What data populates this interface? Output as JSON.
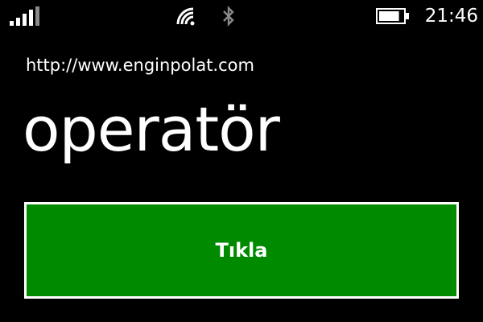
{
  "status_bar": {
    "time": "21:46",
    "icons": {
      "signal": "signal-strength-icon",
      "wifi": "wifi-icon",
      "bluetooth": "bluetooth-icon",
      "battery": "battery-icon"
    },
    "battery_level": 0.85,
    "signal_active_bars": 4,
    "signal_total_bars": 5
  },
  "app": {
    "url": "http://www.enginpolat.com"
  },
  "page": {
    "title": "operatör"
  },
  "button": {
    "label": "Tıkla"
  },
  "colors": {
    "background": "#000000",
    "button_fill": "#008a00",
    "button_border": "#ffffff",
    "text": "#ffffff",
    "muted_icon": "#8a8a8a"
  }
}
